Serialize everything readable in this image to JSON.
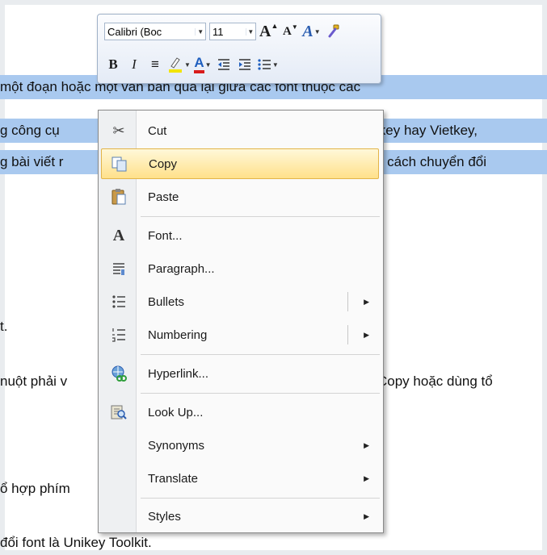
{
  "document": {
    "lines": [
      "một đoạn hoặc một văn bản qua lại giữa các font thuộc các",
      "g công cụ chuyển mã như Unikey hay Vietkey,",
      "g bài viết này sẽ hướng dẫn cách chuyển đổi",
      "t.",
      "nuột phải vào vùng chọn, chọn Copy hoặc dùng tổ",
      "ổ hợp phím",
      "đổi font là Unikey Toolkit."
    ],
    "visible_fragments": {
      "l1": "một đoạn hoặc một văn bản qua lại giữa các font thuộc các",
      "l2_left": "g công cụ",
      "l2_right": "ikey hay Vietkey,",
      "l3_left": "g bài viết r",
      "l3_right": "n cách chuyển đổi",
      "l4": "t.",
      "l5_left": "nuột phải v",
      "l5_right": "Copy hoặc dùng tổ",
      "l6": "ổ hợp phím",
      "l7": "đổi font là Unikey Toolkit."
    }
  },
  "mini_toolbar": {
    "font_name": "Calibri (Boc",
    "font_size": "11",
    "grow_font": "A",
    "shrink_font": "A",
    "styles": "A",
    "bold": "B",
    "italic": "I",
    "align": "≡",
    "font_color": "A",
    "colors": {
      "highlight": "#f2e400",
      "font_color": "#d81b1b",
      "accent_blue": "#1f5fbf"
    }
  },
  "context_menu": {
    "items": [
      {
        "label": "Cut",
        "icon": "scissors-icon",
        "glyph": "✂"
      },
      {
        "label": "Copy",
        "icon": "copy-icon",
        "glyph": "⧉",
        "highlighted": true
      },
      {
        "label": "Paste",
        "icon": "paste-icon",
        "glyph": "📋"
      },
      {
        "label": "Font...",
        "icon": "font-icon",
        "glyph": "A"
      },
      {
        "label": "Paragraph...",
        "icon": "paragraph-icon",
        "glyph": "¶"
      },
      {
        "label": "Bullets",
        "icon": "bullets-icon",
        "glyph": "☰",
        "submenu": true
      },
      {
        "label": "Numbering",
        "icon": "numbering-icon",
        "glyph": "☷",
        "submenu": true
      },
      {
        "label": "Hyperlink...",
        "icon": "hyperlink-icon",
        "glyph": "🔗"
      },
      {
        "label": "Look Up...",
        "icon": "lookup-icon",
        "glyph": "🔍"
      },
      {
        "label": "Synonyms",
        "submenu": true
      },
      {
        "label": "Translate",
        "submenu": true
      },
      {
        "label": "Styles",
        "submenu": true
      }
    ],
    "submenu_arrow": "▶"
  }
}
